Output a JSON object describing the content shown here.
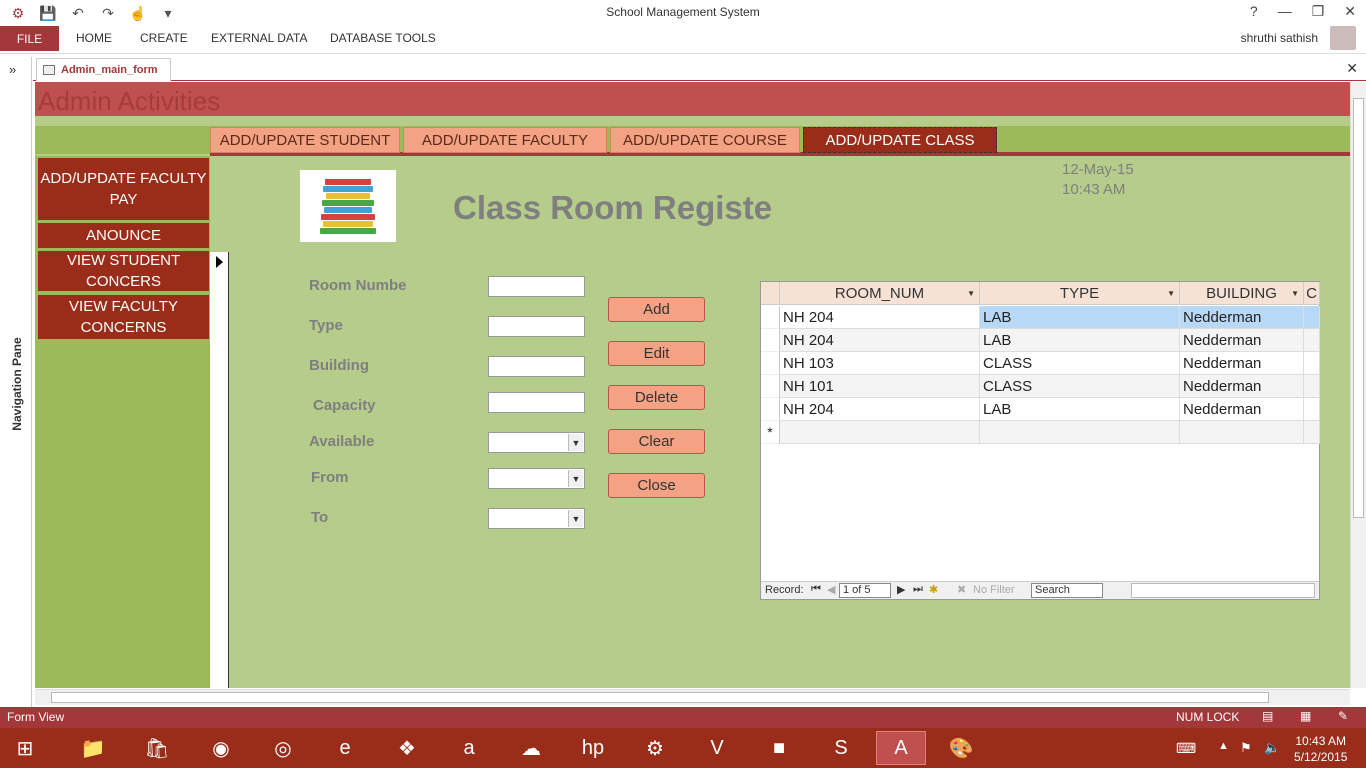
{
  "window": {
    "title": "School Management System",
    "user": "shruthi sathish"
  },
  "ribbon": {
    "file": "FILE",
    "tabs": [
      "HOME",
      "CREATE",
      "EXTERNAL DATA",
      "DATABASE TOOLS"
    ]
  },
  "navpane": {
    "label": "Navigation Pane"
  },
  "document": {
    "tab": "Admin_main_form"
  },
  "form": {
    "header": "Admin Activities",
    "tabs": [
      "ADD/UPDATE STUDENT",
      "ADD/UPDATE FACULTY",
      "ADD/UPDATE COURSE",
      "ADD/UPDATE CLASS"
    ],
    "sidebar": [
      "ADD/UPDATE FACULTY PAY",
      "ANOUNCE",
      "VIEW STUDENT CONCERS",
      "VIEW FACULTY CONCERNS"
    ],
    "title": "Class Room Registery",
    "date": "12-May-15",
    "time": "10:43 AM",
    "labels": {
      "room": "Room Numbe",
      "type": "Type",
      "building": "Building",
      "capacity": "Capacity",
      "available": "Available",
      "from": "From",
      "to": "To"
    },
    "buttons": {
      "add": "Add",
      "edit": "Edit",
      "delete": "Delete",
      "clear": "Clear",
      "close": "Close"
    }
  },
  "grid": {
    "columns": [
      "ROOM_NUM",
      "TYPE",
      "BUILDING",
      "C"
    ],
    "rows": [
      [
        "NH 204",
        "LAB",
        "Nedderman"
      ],
      [
        "NH 204",
        "LAB",
        "Nedderman"
      ],
      [
        "NH 103",
        "CLASS",
        "Nedderman"
      ],
      [
        "NH 101",
        "CLASS",
        "Nedderman"
      ],
      [
        "NH 204",
        "LAB",
        "Nedderman"
      ]
    ],
    "record_label": "Record:",
    "record_value": "1 of 5",
    "filter": "No Filter",
    "search": "Search"
  },
  "status": {
    "left": "Form View",
    "numlock": "NUM LOCK"
  },
  "taskbar": {
    "time": "10:43 AM",
    "date": "5/12/2015"
  },
  "colors": {
    "accent": "#a4373a",
    "form_bg": "#b5cc8a",
    "button": "#f3a283",
    "sidebar_btn": "#9a2d1a"
  }
}
